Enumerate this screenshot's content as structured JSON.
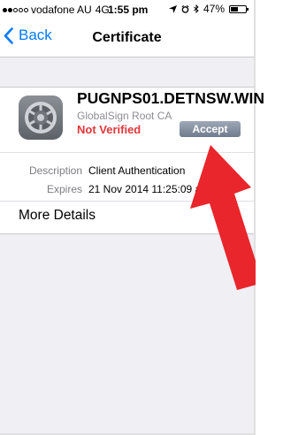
{
  "status_bar": {
    "carrier": "vodafone AU",
    "network": "4G",
    "time": "1:55 pm",
    "battery_percent": "47%",
    "battery_level": 0.47,
    "signal_bars_filled": 2,
    "signal_bars_total": 5
  },
  "nav": {
    "back_label": "Back",
    "title": "Certificate"
  },
  "certificate": {
    "name": "PUGNPS01.DETNSW.WIN",
    "issuer": "GlobalSign Root CA",
    "status": "Not Verified",
    "status_color": "#e1363a",
    "accept_label": "Accept",
    "icon": "settings-gear-icon"
  },
  "details": {
    "description_label": "Description",
    "description_value": "Client Authentication",
    "expires_label": "Expires",
    "expires_value": "21 Nov 2014 11:25:09 am",
    "more_details_label": "More Details"
  },
  "colors": {
    "accent": "#007aff",
    "arrow": "#e8262b",
    "background": "#efeff4"
  }
}
